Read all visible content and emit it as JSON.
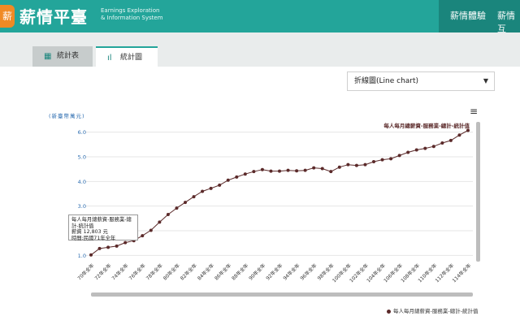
{
  "header": {
    "logo_glyph": "薪",
    "brand_title": "薪情平臺",
    "brand_sub_line1": "Earnings Exploration",
    "brand_sub_line2": "& Information System",
    "nav_items": [
      "薪情體驗",
      "薪情互"
    ]
  },
  "tabs": {
    "table_label": "統計表",
    "table_icon": "table-icon",
    "chart_label": "統計圖",
    "chart_icon": "bar-chart-icon"
  },
  "chart_type_select": {
    "selected": "折線圖(Line chart)"
  },
  "tooltip": {
    "line1": "每人每月總薪資-服務業-總計-統計值",
    "line2": "薪資 12,803 元",
    "line3": "時間:民國71年全年"
  },
  "legend_label": "每人每月總薪資-服務業-總計-統計值",
  "series_end_label": "每人每月總薪資-服務業-總計-統計值",
  "colors": {
    "header": "#23a59a",
    "nav": "#1a857c",
    "line": "#5b2a2a"
  },
  "chart_data": {
    "type": "line",
    "ylabel": "(新臺幣萬元)",
    "ylim": [
      0.75,
      6.25
    ],
    "yticks": [
      "1.0",
      "2.0",
      "3.0",
      "4.0",
      "5.0",
      "6.0"
    ],
    "ytick_values": [
      1,
      2,
      3,
      4,
      5,
      6
    ],
    "x_labels": [
      "70年全年",
      "72年全年",
      "74年全年",
      "76年全年",
      "78年全年",
      "80年全年",
      "82年全年",
      "84年全年",
      "86年全年",
      "88年全年",
      "90年全年",
      "92年全年",
      "94年全年",
      "96年全年",
      "98年全年",
      "100年全年",
      "102年全年",
      "104年全年",
      "106年全年",
      "108年全年",
      "110年全年",
      "112年全年",
      "114年全年"
    ],
    "x": [
      70,
      71,
      72,
      73,
      74,
      75,
      76,
      77,
      78,
      79,
      80,
      81,
      82,
      83,
      84,
      85,
      86,
      87,
      88,
      89,
      90,
      91,
      92,
      93,
      94,
      95,
      96,
      97,
      98,
      99,
      100,
      101,
      102,
      103,
      104,
      105,
      106,
      107,
      108,
      109,
      110,
      111,
      112,
      113,
      114
    ],
    "series": [
      {
        "name": "每人每月總薪資-服務業-總計-統計值",
        "values": [
          1.02,
          1.28,
          1.33,
          1.38,
          1.52,
          1.6,
          1.8,
          2.02,
          2.35,
          2.66,
          2.92,
          3.15,
          3.38,
          3.6,
          3.72,
          3.85,
          4.05,
          4.18,
          4.3,
          4.4,
          4.48,
          4.42,
          4.42,
          4.45,
          4.43,
          4.45,
          4.55,
          4.52,
          4.4,
          4.58,
          4.68,
          4.65,
          4.68,
          4.8,
          4.88,
          4.92,
          5.05,
          5.18,
          5.28,
          5.34,
          5.42,
          5.56,
          5.66,
          5.88,
          6.07
        ]
      }
    ]
  }
}
